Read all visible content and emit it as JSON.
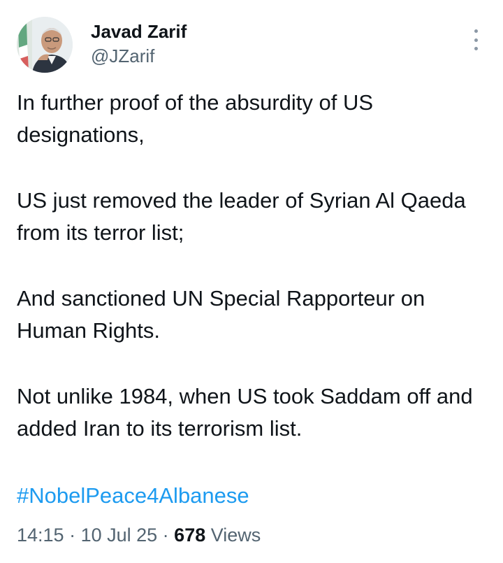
{
  "author": {
    "display_name": "Javad Zarif",
    "handle": "@JZarif",
    "avatar": "profile-photo"
  },
  "tweet": {
    "paragraphs": [
      "In further proof of the absurdity of US designations,",
      "US just removed the leader of Syrian Al Qaeda from its terror list;",
      "And sanctioned UN Special Rapporteur on Human Rights.",
      "Not unlike 1984, when US took Saddam off and added Iran to its terrorism list."
    ],
    "hashtag": "#NobelPeace4Albanese"
  },
  "meta": {
    "time": "14:15",
    "separator1": " · ",
    "date": "10 Jul 25",
    "separator2": " · ",
    "views_count": "678",
    "views_label": " Views"
  },
  "icons": {
    "more": "more-vertical-icon"
  },
  "colors": {
    "text": "#0f1419",
    "secondary": "#536471",
    "link": "#1d9bf0"
  }
}
